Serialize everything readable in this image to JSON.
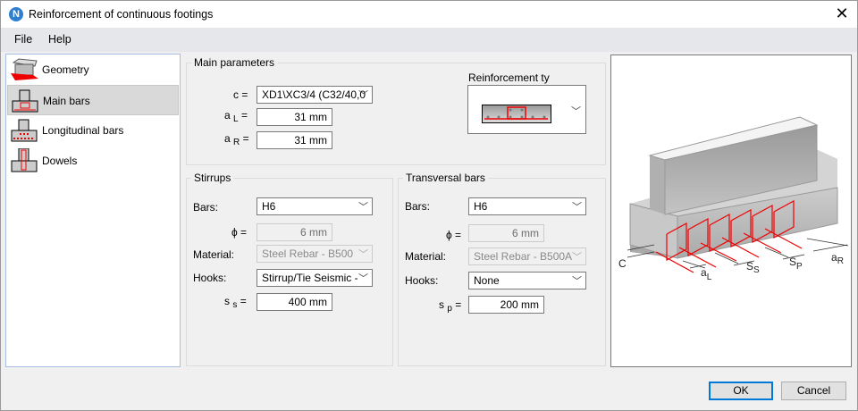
{
  "window": {
    "title": "Reinforcement of continuous footings",
    "logo": "N"
  },
  "menu": [
    "File",
    "Help"
  ],
  "sidebar": {
    "items": [
      {
        "label": "Geometry"
      },
      {
        "label": "Main bars",
        "selected": true
      },
      {
        "label": "Longitudinal bars"
      },
      {
        "label": "Dowels"
      }
    ]
  },
  "main": {
    "title": "Main parameters",
    "c_label": "c =",
    "c_value": "XD1\\XC3/4 (C32/40,0",
    "aL_label": "a",
    "aL_sub": "L",
    "aL_eq": "=",
    "aL_value": "31 mm",
    "aR_label": "a",
    "aR_sub": "R",
    "aR_eq": "=",
    "aR_value": "31 mm",
    "reinf_type_label": "Reinforcement ty"
  },
  "stirrups": {
    "title": "Stirrups",
    "bars_label": "Bars:",
    "bars_value": "H6",
    "phi_label": "ϕ =",
    "phi_value": "6 mm",
    "material_label": "Material:",
    "material_value": "Steel Rebar - B500",
    "hooks_label": "Hooks:",
    "hooks_value": "Stirrup/Tie Seismic -",
    "s_label": "s",
    "s_sub": "s",
    "s_eq": "=",
    "s_value": "400 mm"
  },
  "transversal": {
    "title": "Transversal bars",
    "bars_label": "Bars:",
    "bars_value": "H6",
    "phi_label": "ϕ =",
    "phi_value": "6 mm",
    "material_label": "Material:",
    "material_value": "Steel Rebar - B500A",
    "hooks_label": "Hooks:",
    "hooks_value": "None",
    "s_label": "s",
    "s_sub": "p",
    "s_eq": "=",
    "s_value": "200 mm"
  },
  "diagram": {
    "labels": {
      "c": "C",
      "aL": "a",
      "aL_sub": "L",
      "ss": "S",
      "ss_sub": "S",
      "sp": "S",
      "sp_sub": "P",
      "aR": "a",
      "aR_sub": "R"
    }
  },
  "buttons": {
    "ok": "OK",
    "cancel": "Cancel"
  },
  "colors": {
    "accent": "#0078d7",
    "rebar": "#ff0000"
  }
}
